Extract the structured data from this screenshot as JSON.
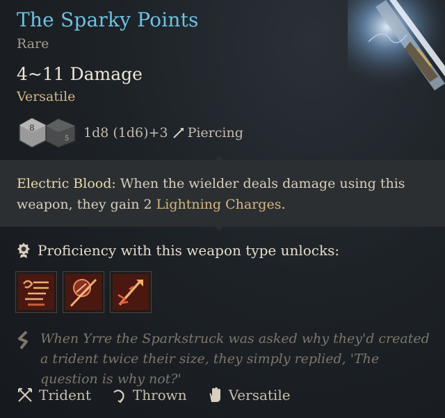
{
  "item": {
    "name": "The Sparky Points",
    "rarity": "Rare",
    "damage": "4~11 Damage",
    "property": "Versatile",
    "dice": {
      "face_primary": "8",
      "face_secondary": "5"
    },
    "roll": "1d8 (1d6)+3",
    "damage_type": "Piercing",
    "damage_type_icon": "pierce-icon"
  },
  "effect": {
    "name": "Electric Blood:",
    "text_before": " When the wielder deals damage using this weapon, they gain 2 ",
    "keyword": "Lightning Charges",
    "text_after": "."
  },
  "proficiency": {
    "label": "Proficiency with this weapon type unlocks:",
    "actions": [
      "action-icon-1",
      "action-icon-2",
      "action-icon-3"
    ]
  },
  "flavor": "When Yrre the Sparkstruck was asked why they'd created a trident twice their size, they simply replied, 'The question is why not?'",
  "tags": [
    {
      "label": "Trident",
      "icon": "trident-icon"
    },
    {
      "label": "Thrown",
      "icon": "thrown-icon"
    },
    {
      "label": "Versatile",
      "icon": "hand-icon"
    }
  ],
  "colors": {
    "title": "#6fc2e2",
    "property": "#d3b886",
    "keyword": "#d6b77e",
    "background": "#1d2227"
  }
}
